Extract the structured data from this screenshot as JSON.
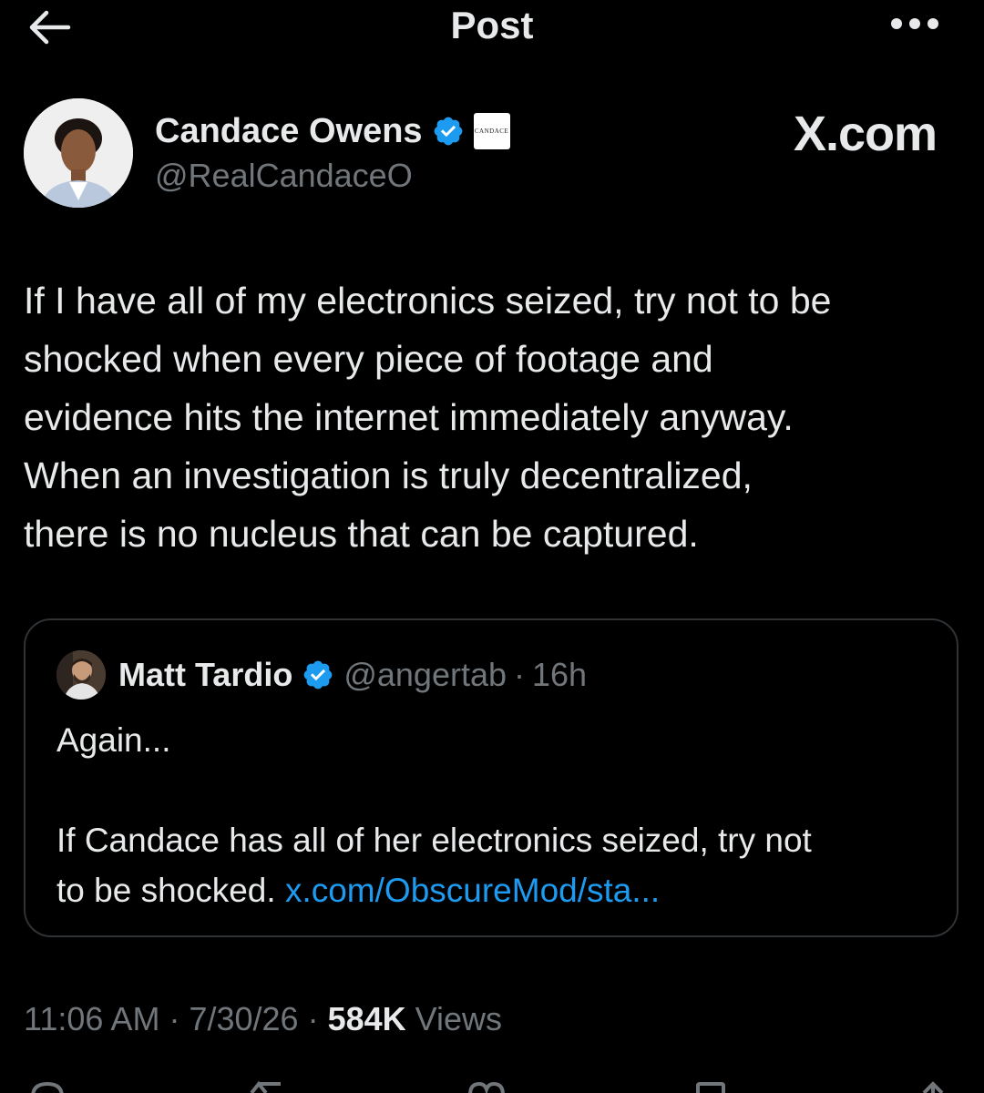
{
  "header": {
    "title": "Post",
    "back_icon": "arrow-left-icon",
    "more_icon": "more-horizontal-icon"
  },
  "author": {
    "name": "Candace Owens",
    "handle": "@RealCandaceO",
    "verified": true,
    "affiliate_badge_text": "CANDACE"
  },
  "watermark": "X.com",
  "post": {
    "lines": [
      "If I have all of my electronics seized, try not to be",
      "shocked when every piece of footage and",
      "evidence hits the internet immediately anyway.",
      "When an investigation is truly decentralized,",
      "there is no nucleus that can be captured."
    ]
  },
  "quoted_post": {
    "name": "Matt Tardio",
    "handle": "@angertab",
    "separator": "·",
    "time": "16h",
    "verified": true,
    "text_line_1": "Again...",
    "text_line_2": "If Candace has all of her electronics seized, try not",
    "text_line_3_prefix": "to be shocked.",
    "link": "x.com/ObscureMod/sta..."
  },
  "meta": {
    "time": "11:06 AM",
    "separator": "·",
    "date": "7/30/26",
    "views_count": "584K",
    "views_label": "Views"
  },
  "colors": {
    "background": "#000000",
    "text": "#e7e9ea",
    "secondary_text": "#71767b",
    "link": "#1d9bf0",
    "verified_badge": "#1d9bf0",
    "border": "#2f3336"
  }
}
